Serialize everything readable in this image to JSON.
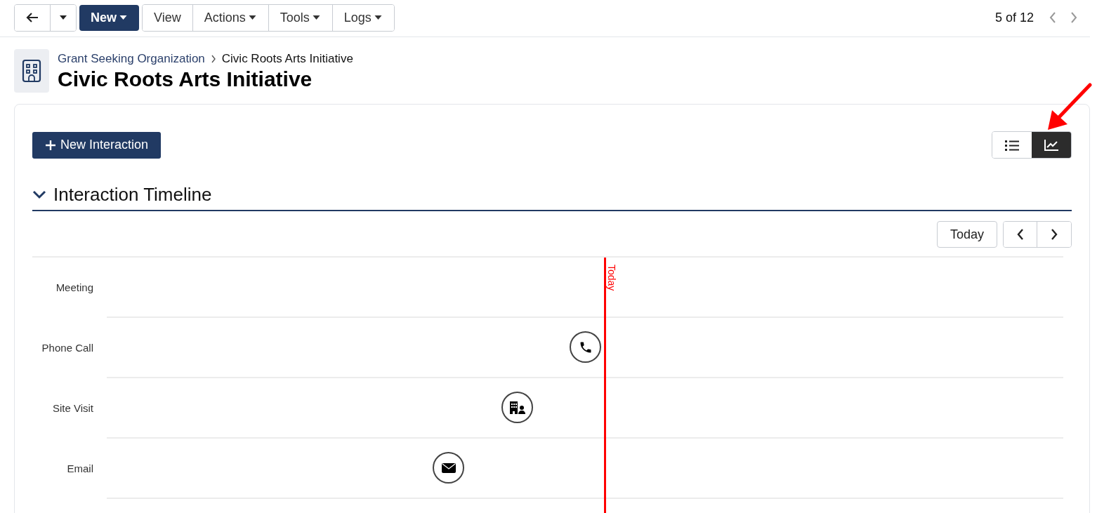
{
  "toolbar": {
    "new_button": "New",
    "buttons": [
      {
        "label": "View",
        "dropdown": false
      },
      {
        "label": "Actions",
        "dropdown": true
      },
      {
        "label": "Tools",
        "dropdown": true
      },
      {
        "label": "Logs",
        "dropdown": true
      }
    ]
  },
  "pager": {
    "text": "5 of 12"
  },
  "breadcrumb": [
    {
      "label": "Grant Seeking Organization",
      "kind": "link"
    },
    {
      "label": "Civic Roots Arts Initiative",
      "kind": "current"
    }
  ],
  "title": "Civic Roots Arts Initiative",
  "new_interaction_button": "New Interaction",
  "view_toggle": [
    {
      "kind": "list",
      "selected": false
    },
    {
      "kind": "chart",
      "selected": true
    }
  ],
  "section": {
    "title": "Interaction Timeline",
    "expanded": true
  },
  "timeline_nav": {
    "today_button": "Today"
  },
  "today_marker": "Today",
  "rows": [
    {
      "label": "Meeting",
      "kind": "none"
    },
    {
      "label": "Phone Call",
      "kind": "phone"
    },
    {
      "label": "Site Visit",
      "kind": "visit"
    },
    {
      "label": "Email",
      "kind": "email"
    }
  ]
}
